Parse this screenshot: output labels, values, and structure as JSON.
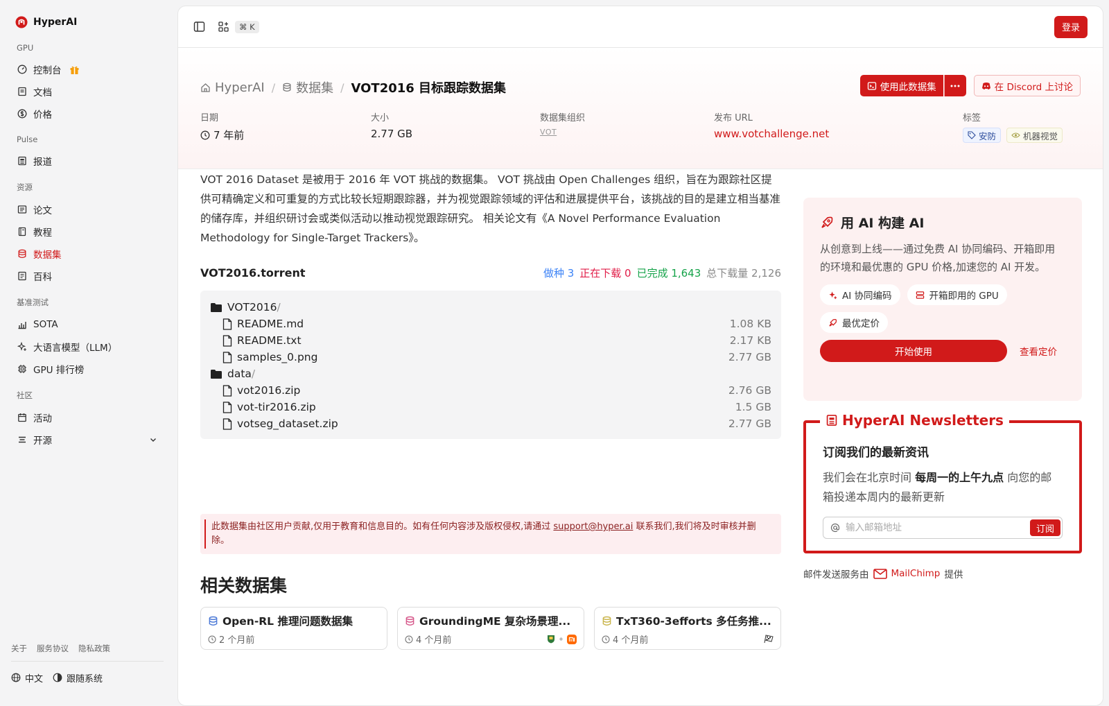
{
  "brand": {
    "name": "HyperAI"
  },
  "sidebar": {
    "sections": [
      {
        "title": "GPU",
        "items": [
          {
            "label": "控制台"
          },
          {
            "label": "文档"
          },
          {
            "label": "价格"
          }
        ]
      },
      {
        "title": "Pulse",
        "items": [
          {
            "label": "报道"
          }
        ]
      },
      {
        "title": "资源",
        "items": [
          {
            "label": "论文"
          },
          {
            "label": "教程"
          },
          {
            "label": "数据集"
          },
          {
            "label": "百科"
          }
        ]
      },
      {
        "title": "基准测试",
        "items": [
          {
            "label": "SOTA"
          },
          {
            "label": "大语言模型（LLM）"
          },
          {
            "label": "GPU 排行榜"
          }
        ]
      },
      {
        "title": "社区",
        "items": [
          {
            "label": "活动"
          },
          {
            "label": "开源"
          }
        ]
      }
    ],
    "footer_links": [
      "关于",
      "服务协议",
      "隐私政策"
    ],
    "language": "中文",
    "tracking": "跟随系统"
  },
  "topbar": {
    "shortcut": "⌘ K",
    "login": "登录"
  },
  "breadcrumb": {
    "home": "HyperAI",
    "section": "数据集",
    "current": "VOT2016 目标跟踪数据集"
  },
  "actions": {
    "use_dataset": "使用此数据集",
    "discord": "在 Discord 上讨论"
  },
  "meta": {
    "date_label": "日期",
    "date_value": "7 年前",
    "size_label": "大小",
    "size_value": "2.77 GB",
    "org_label": "数据集组织",
    "org_logo": "VOT",
    "url_label": "发布 URL",
    "url_value": "www.votchallenge.net",
    "tags_label": "标签",
    "tags": [
      "安防",
      "机器视觉"
    ]
  },
  "description": "VOT 2016 Dataset 是被用于 2016 年 VOT 挑战的数据集。 VOT 挑战由 Open Challenges 组织，旨在为跟踪社区提供可精确定义和可重复的方式比较长短期跟踪器，并为视觉跟踪领域的评估和进展提供平台，该挑战的目的是建立相当基准的储存库，并组织研讨会或类似活动以推动视觉跟踪研究。 相关论文有《A Novel Performance Evaluation Methodology for Single-Target Trackers》。",
  "torrent": {
    "name": "VOT2016.torrent",
    "seeding": "做种 3",
    "downloading": "正在下载 0",
    "completed": "已完成 1,643",
    "total": "总下载量 2,126",
    "folders": [
      {
        "name": "VOT2016",
        "files": [
          {
            "name": "README.md",
            "size": "1.08 KB"
          },
          {
            "name": "README.txt",
            "size": "2.17 KB"
          },
          {
            "name": "samples_0.png",
            "size": "2.77 GB"
          }
        ]
      },
      {
        "name": "data",
        "files": [
          {
            "name": "vot2016.zip",
            "size": "2.76 GB"
          },
          {
            "name": "vot-tir2016.zip",
            "size": "1.5 GB"
          },
          {
            "name": "votseg_dataset.zip",
            "size": "2.77 GB"
          }
        ]
      }
    ]
  },
  "notice": {
    "before": "此数据集由社区用户贡献,仅用于教育和信息目的。如有任何内容涉及版权侵权,请通过 ",
    "email": "support@hyper.ai",
    "after": " 联系我们,我们将及时审核并删除。"
  },
  "related": {
    "title": "相关数据集",
    "cards": [
      {
        "title": "Open-RL 推理问题数据集",
        "time": "2 个月前"
      },
      {
        "title": "GroundingME 复杂场景理...",
        "time": "4 个月前"
      },
      {
        "title": "TxT360-3efforts 多任务推...",
        "time": "4 个月前"
      }
    ]
  },
  "promo": {
    "title": "用 AI 构建 AI",
    "desc": "从创意到上线——通过免费 AI 协同编码、开箱即用的环境和最优惠的 GPU 价格,加速您的 AI 开发。",
    "chips": [
      "AI 协同编码",
      "开箱即用的 GPU",
      "最优定价"
    ],
    "start": "开始使用",
    "pricing": "查看定价"
  },
  "newsletter": {
    "legend": "HyperAI Newsletters",
    "heading": "订阅我们的最新资讯",
    "p_before": "我们会在北京时间 ",
    "p_bold": "每周一的上午九点",
    "p_after": " 向您的邮箱投递本周内的最新更新",
    "placeholder": "输入邮箱地址",
    "subscribe": "订阅",
    "mailer_before": "邮件发送服务由",
    "mailer_name": "MailChimp",
    "mailer_after": "提供"
  },
  "colors": {
    "accent": "#d11a1a",
    "seed": "#3b82f6",
    "downloading": "#e11d48",
    "completed": "#16a34a"
  }
}
